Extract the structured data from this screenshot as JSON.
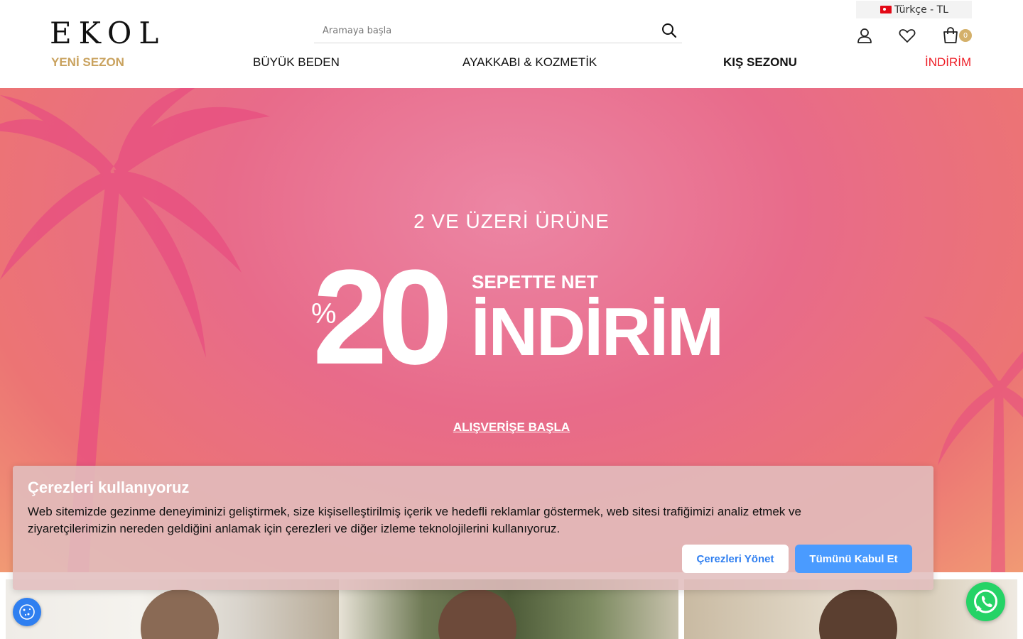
{
  "header": {
    "logo_text": "EKOL",
    "search": {
      "placeholder": "Aramaya başla",
      "value": ""
    },
    "language": {
      "label": "Türkçe - TL"
    },
    "cart": {
      "count": "0"
    }
  },
  "nav": {
    "items": [
      {
        "label": "YENİ SEZON"
      },
      {
        "label": "BÜYÜK BEDEN"
      },
      {
        "label": "AYAKKABI & KOZMETİK"
      },
      {
        "label": "KIŞ SEZONU"
      },
      {
        "label": "İNDİRİM"
      }
    ]
  },
  "hero": {
    "subtitle": "2 VE ÜZERİ ÜRÜNE",
    "percent_sign": "%",
    "number": "20",
    "net_text": "SEPETTE NET",
    "headline": "İNDİRİM",
    "cta": "ALIŞVERİŞE BAŞLA"
  },
  "cookie_banner": {
    "title": "Çerezleri kullanıyoruz",
    "text": "Web sitemizde gezinme deneyiminizi geliştirmek, size kişiselleştirilmiş içerik ve hedefli reklamlar göstermek, web sitesi trafiğimizi analiz etmek ve ziyaretçilerimizin nereden geldiğini anlamak için çerezleri ve diğer izleme teknolojilerini kullanıyoruz.",
    "manage_label": "Çerezleri Yönet",
    "accept_label": "Tümünü Kabul Et"
  },
  "icons": {
    "search": "search-icon",
    "user": "user-icon",
    "favorites": "heart-icon",
    "cart": "shopping-bag-icon",
    "cookie": "cookie-icon",
    "whatsapp": "whatsapp-icon",
    "flag": "turkey-flag-icon"
  },
  "colors": {
    "accent_gold": "#c9a25e",
    "sale_red": "#ee1c25",
    "accept_blue": "#4a9bff",
    "whatsapp_green": "#25d366"
  }
}
